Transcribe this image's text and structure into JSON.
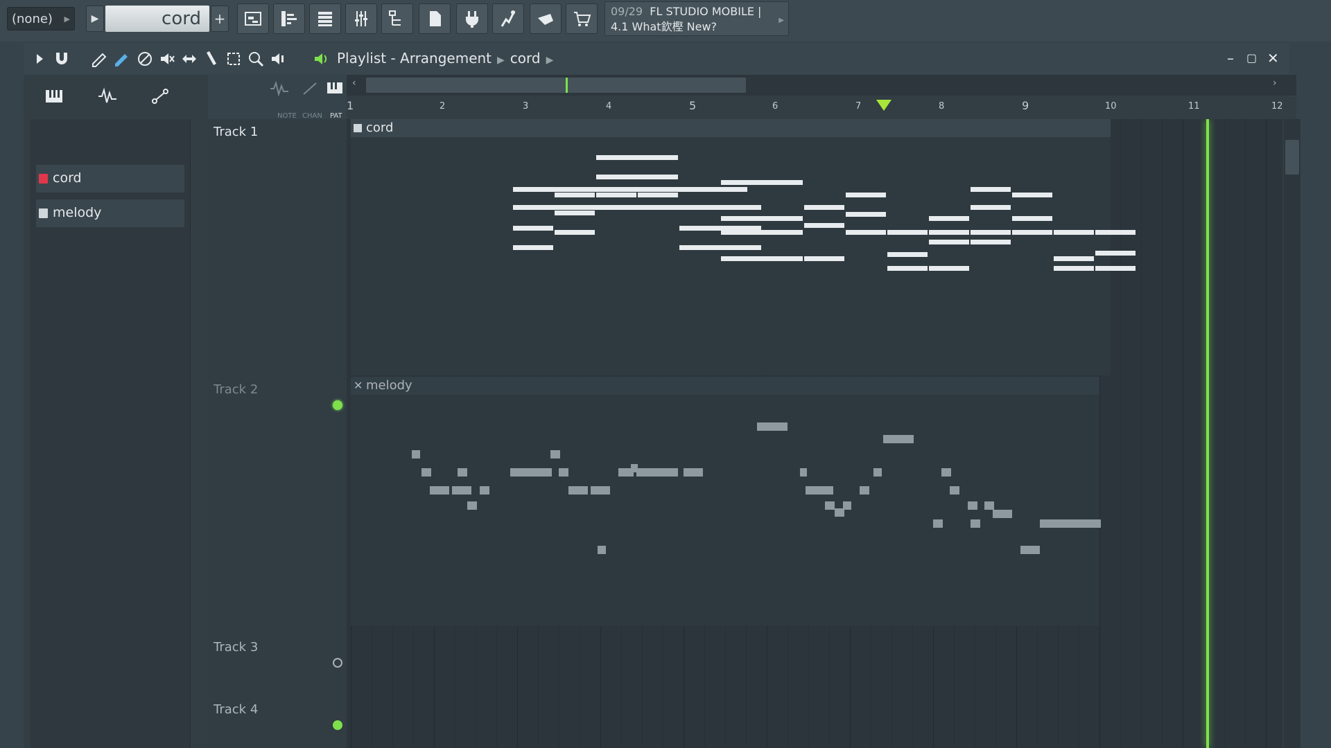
{
  "topbar": {
    "pattern_select": "(none)",
    "pattern_name": "cord",
    "news_date": "09/29",
    "news_title": "FL STUDIO MOBILE |",
    "news_line2": "4.1 What欽樫 New?",
    "buttons": [
      "playlist-icon",
      "piano-roll-icon",
      "channel-rack-icon",
      "mixer-icon",
      "browser-icon",
      "plugin-picker-icon",
      "plugin-icon",
      "tempo-icon",
      "project-icon",
      "cart-icon"
    ]
  },
  "window": {
    "breadcrumb": [
      "Playlist - Arrangement",
      "cord"
    ],
    "tool_icons": [
      "play-icon",
      "magnet-icon",
      "pencil-icon",
      "paint-icon",
      "delete-icon",
      "mute-icon",
      "slip-icon",
      "slice-icon",
      "select-icon",
      "zoom-icon",
      "playback-icon"
    ],
    "mini_labels": [
      "NOTE",
      "CHAN",
      "PAT"
    ]
  },
  "browser": {
    "patterns": [
      {
        "label": "cord",
        "selected": true
      },
      {
        "label": "melody",
        "selected": false
      }
    ]
  },
  "tracks": [
    {
      "label": "Track 1",
      "status": "on"
    },
    {
      "label": "Track 2",
      "status": "off"
    },
    {
      "label": "Track 3",
      "status": "on"
    },
    {
      "label": "Track 4",
      "status": "on"
    }
  ],
  "ruler": {
    "bars": [
      "1",
      "2",
      "3",
      "4",
      "5",
      "6",
      "7",
      "8",
      "9",
      "10",
      "11",
      "12"
    ]
  },
  "clips": {
    "cord": {
      "label": "cord"
    },
    "melody": {
      "label": "melody"
    }
  },
  "colors": {
    "accent": "#7fe04d",
    "note": "#e8ecef",
    "clip_bg": "#2c373d",
    "background": "#37434b"
  }
}
